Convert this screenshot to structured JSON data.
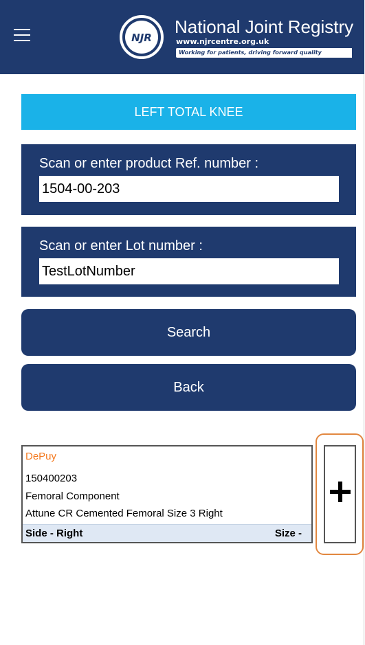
{
  "header": {
    "menu_icon": "hamburger-menu-icon",
    "logo": {
      "badge": "NJR",
      "title": "National Joint Registry",
      "url": "www.njrcentre.org.uk",
      "tagline": "Working for patients, driving forward quality"
    }
  },
  "procedure": {
    "label": "LEFT TOTAL KNEE"
  },
  "ref_panel": {
    "label": "Scan or enter product Ref. number :",
    "value": "1504-00-203"
  },
  "lot_panel": {
    "label": "Scan or enter Lot number :",
    "value": "TestLotNumber"
  },
  "buttons": {
    "search": "Search",
    "back": "Back"
  },
  "result": {
    "manufacturer": "DePuy",
    "ref": "150400203",
    "type": "Femoral Component",
    "description": "Attune CR Cemented Femoral Size 3 Right",
    "side_label": "Side  -  Right",
    "size_label": "Size  -",
    "add_icon": "plus-icon"
  },
  "colors": {
    "navy": "#1f3a6e",
    "accent_blue": "#1ab2e8",
    "manufacturer_orange": "#f47a20",
    "highlight_orange": "#e2873f",
    "footer_bg": "#dfe8f4"
  }
}
